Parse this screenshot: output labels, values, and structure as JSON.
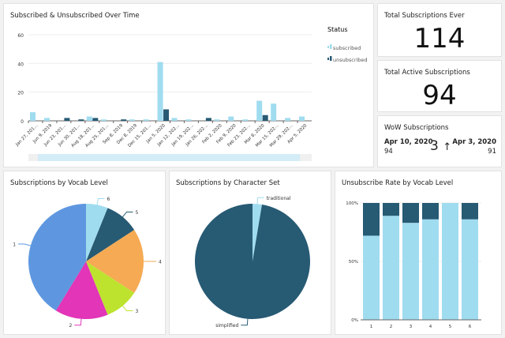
{
  "colors": {
    "subscribed": "#a0dcef",
    "unsubscribed": "#275a73",
    "level1": "#5e97e0",
    "level2": "#e235b8",
    "level3": "#bde32f",
    "level4": "#f5aa53",
    "level5": "#275a73",
    "level6": "#a0dcef"
  },
  "kpis": {
    "total_ever": {
      "title": "Total Subscriptions Ever",
      "value": "114"
    },
    "total_active": {
      "title": "Total Active Subscriptions",
      "value": "94"
    },
    "wow": {
      "title": "WoW Subscriptions",
      "current_date": "Apr 10, 2020",
      "current_value": "94",
      "delta": "3",
      "delta_icon": "arrow-up-icon",
      "arrow": "↑",
      "prev_date": "Apr 3, 2020",
      "prev_value": "91"
    }
  },
  "chart_data": [
    {
      "type": "bar",
      "title": "Subscribed & Unsubscribed Over Time",
      "legend_title": "Status",
      "legend_placement": "right",
      "ylim": [
        0,
        60
      ],
      "yticks": [
        0,
        20,
        40,
        60
      ],
      "grid": true,
      "categories": [
        "Jan 27, 201…",
        "Jun 9, 2019",
        "Jun 23, 201…",
        "Jun 30, 201…",
        "Aug 18, 201…",
        "Aug 25, 201…",
        "Sep 8, 2019",
        "Dec 8, 2019",
        "Dec 15, 201…",
        "Jan 5, 2020",
        "Jan 12, 202…",
        "Jan 19, 202…",
        "Jan 26, 202…",
        "Feb 2, 2020",
        "Feb 9, 2020",
        "Feb 23, 202…",
        "Mar 8, 2020",
        "Mar 15, 202…",
        "Mar 29, 202…",
        "Apr 5, 2020"
      ],
      "series": [
        {
          "name": "subscribed",
          "values": [
            6,
            2,
            0,
            0,
            3,
            1,
            0,
            1,
            1,
            41,
            2,
            1,
            0,
            1,
            3,
            1,
            14,
            12,
            2,
            3
          ]
        },
        {
          "name": "unsubscribed",
          "values": [
            0,
            0,
            2,
            1,
            2,
            0,
            1,
            0,
            0,
            8,
            0,
            0,
            2,
            0,
            0,
            0,
            4,
            0,
            0,
            0
          ]
        }
      ]
    },
    {
      "type": "pie",
      "title": "Subscriptions by Vocab Level",
      "labels": [
        "6",
        "5",
        "4",
        "3",
        "2",
        "1"
      ],
      "values": [
        7,
        11,
        21,
        11,
        17,
        47
      ]
    },
    {
      "type": "pie",
      "title": "Subscriptions by Character Set",
      "labels": [
        "traditional",
        "simplified"
      ],
      "values": [
        3,
        111
      ]
    },
    {
      "type": "bar",
      "stacked": true,
      "title": "Unsubscribe Rate by Vocab Level",
      "categories": [
        "1",
        "2",
        "3",
        "4",
        "5",
        "6"
      ],
      "yticks": [
        "0%",
        "50%",
        "100%"
      ],
      "ylim": [
        0,
        100
      ],
      "series": [
        {
          "name": "subscribed",
          "values": [
            72,
            89,
            83,
            86,
            100,
            86
          ]
        },
        {
          "name": "unsubscribed",
          "values": [
            28,
            11,
            17,
            14,
            0,
            14
          ]
        }
      ]
    }
  ]
}
